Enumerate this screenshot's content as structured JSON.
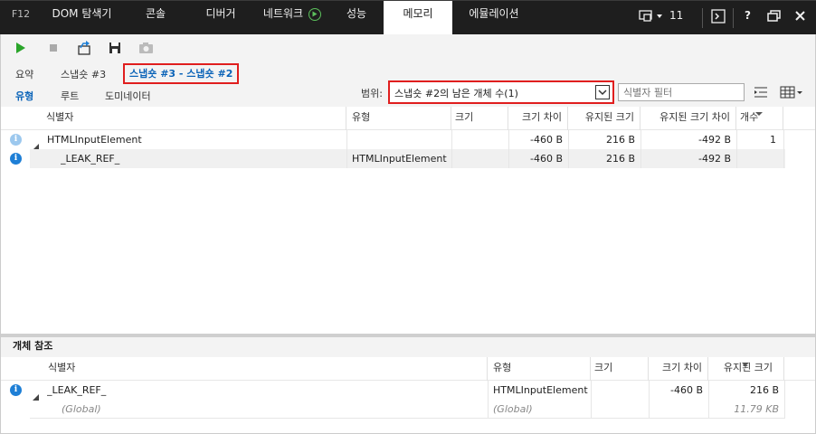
{
  "devtools": {
    "f12": "F12",
    "tabs": [
      "DOM 탐색기",
      "콘솔",
      "디버거",
      "네트워크",
      "성능",
      "메모리",
      "에뮬레이션"
    ],
    "active_tab": "메모리",
    "error_count": "11"
  },
  "subtabs": {
    "summary": "요약",
    "snapshot3": "스냅숏 #3",
    "diff": "스냅숏 #3 - 스냅숏 #2",
    "types": "유형",
    "roots": "루트",
    "dominators": "도미네이터"
  },
  "scope": {
    "label": "범위:",
    "value": "스냅숏 #2의 남은 개체 수(1)"
  },
  "filter": {
    "placeholder": "식별자 필터"
  },
  "main_table": {
    "columns": [
      "식별자",
      "유형",
      "크기",
      "크기 차이",
      "유지된 크기",
      "유지된 크기 차이",
      "개수"
    ],
    "rows": [
      {
        "id": "HTMLInputElement",
        "type": "",
        "size": "",
        "size_diff": "-460 B",
        "retained": "216 B",
        "retained_diff": "-492 B",
        "count": "1"
      },
      {
        "id": "_LEAK_REF_",
        "type": "HTMLInputElement",
        "size": "",
        "size_diff": "-460 B",
        "retained": "216 B",
        "retained_diff": "-492 B",
        "count": ""
      }
    ]
  },
  "refs_panel": {
    "title": "개체 참조",
    "columns": [
      "식별자",
      "유형",
      "크기",
      "크기 차이",
      "유지된 크기"
    ],
    "rows": [
      {
        "id": "_LEAK_REF_",
        "type": "HTMLInputElement",
        "size": "",
        "size_diff": "-460 B",
        "retained": "216 B"
      },
      {
        "id": "(Global)",
        "type": "(Global)",
        "size": "",
        "size_diff": "",
        "retained": "11.79 KB"
      }
    ]
  },
  "colors": {
    "highlight_border": "#e01e1e",
    "info_icon": "#1e7fd6",
    "link_blue": "#0a63b8"
  }
}
